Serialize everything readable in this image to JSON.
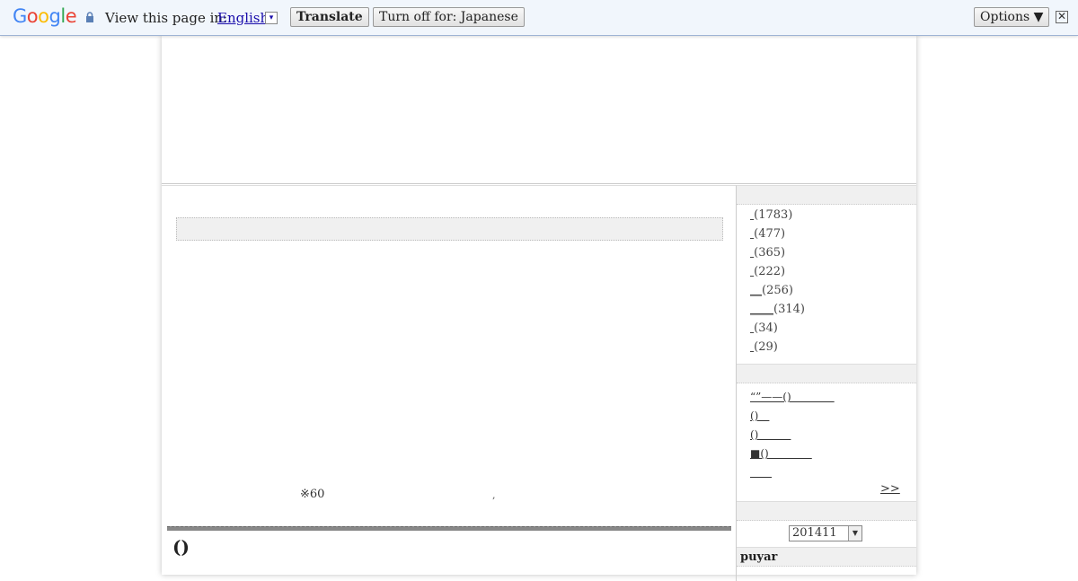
{
  "translate_bar": {
    "logo": "Google",
    "view_text": "View this page in:",
    "language": "English",
    "dropdown_glyph": "▾",
    "translate_label": "Translate",
    "turn_off_label": "Turn off for: Japanese",
    "options_label": "Options ▼",
    "close_glyph": "✕",
    "lock_icon": "lock-icon"
  },
  "content": {
    "note": "※60",
    "comma": ",",
    "post_title": "()"
  },
  "sidebar": {
    "categories": [
      {
        "prefix": "",
        "count": "(1783)"
      },
      {
        "prefix": "",
        "count": "(477)"
      },
      {
        "prefix": "",
        "count": "(365)"
      },
      {
        "prefix": "",
        "count": "(222)"
      },
      {
        "prefix": "__",
        "count": "(256)"
      },
      {
        "prefix": "____",
        "count": "(314)"
      },
      {
        "prefix": "",
        "count": "(34)"
      },
      {
        "prefix": "",
        "count": "(29)"
      }
    ],
    "recent_links": [
      "“”——()＿＿＿＿",
      "()＿",
      "()＿＿＿",
      "■()＿＿＿＿",
      "＿＿"
    ],
    "more_label": ">> ",
    "archive_select": "201411",
    "author": "puyar"
  }
}
